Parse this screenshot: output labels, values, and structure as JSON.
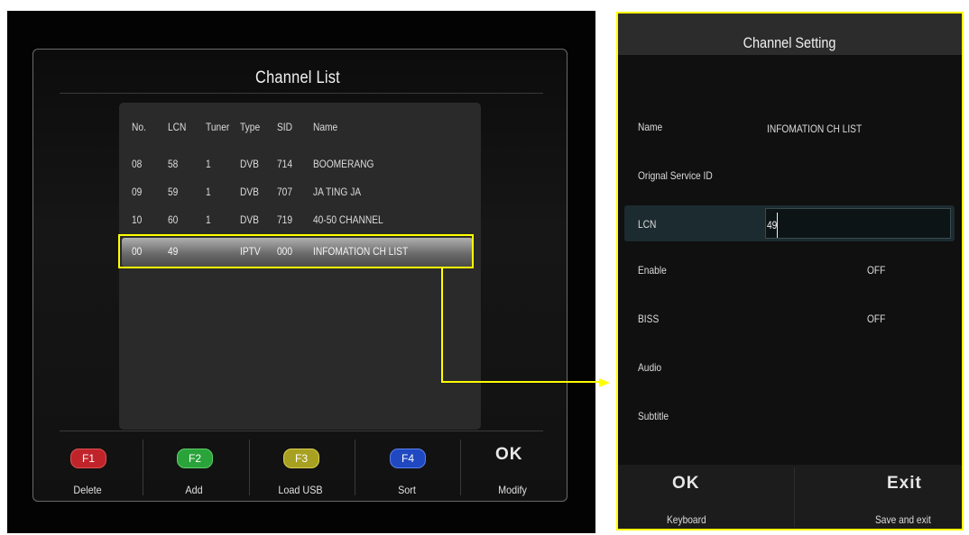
{
  "channel_list": {
    "title": "Channel List",
    "columns": [
      "No.",
      "LCN",
      "Tuner",
      "Type",
      "SID",
      "Name"
    ],
    "rows": [
      {
        "no": "08",
        "lcn": "58",
        "tuner": "1",
        "type": "DVB",
        "sid": "714",
        "name": "BOOMERANG"
      },
      {
        "no": "09",
        "lcn": "59",
        "tuner": "1",
        "type": "DVB",
        "sid": "707",
        "name": "JA TING JA"
      },
      {
        "no": "10",
        "lcn": "60",
        "tuner": "1",
        "type": "DVB",
        "sid": "719",
        "name": "40-50 CHANNEL"
      },
      {
        "no": "00",
        "lcn": "49",
        "tuner": "",
        "type": "IPTV",
        "sid": "000",
        "name": "INFOMATION CH LIST"
      }
    ],
    "function_keys": [
      {
        "key": "F1",
        "label": "Delete",
        "color": "#c0242a"
      },
      {
        "key": "F2",
        "label": "Add",
        "color": "#2aa33a"
      },
      {
        "key": "F3",
        "label": "Load USB",
        "color": "#a8a020"
      },
      {
        "key": "F4",
        "label": "Sort",
        "color": "#2048c0"
      }
    ],
    "ok": {
      "key": "OK",
      "label": "Modify"
    }
  },
  "channel_setting": {
    "title": "Channel Setting",
    "fields": {
      "name": {
        "label": "Name",
        "value": "INFOMATION CH LIST"
      },
      "original_service_id": {
        "label": "Orignal Service ID",
        "value": ""
      },
      "lcn": {
        "label": "LCN",
        "value": "49"
      },
      "enable": {
        "label": "Enable",
        "value": "OFF"
      },
      "biss": {
        "label": "BISS",
        "value": "OFF"
      },
      "audio": {
        "label": "Audio",
        "value": ""
      },
      "subtitle": {
        "label": "Subtitle",
        "value": ""
      }
    },
    "footer": {
      "ok": {
        "key": "OK",
        "label": "Keyboard"
      },
      "exit": {
        "key": "Exit",
        "label": "Save and exit"
      }
    }
  },
  "colors": {
    "highlight": "#ffff00"
  }
}
